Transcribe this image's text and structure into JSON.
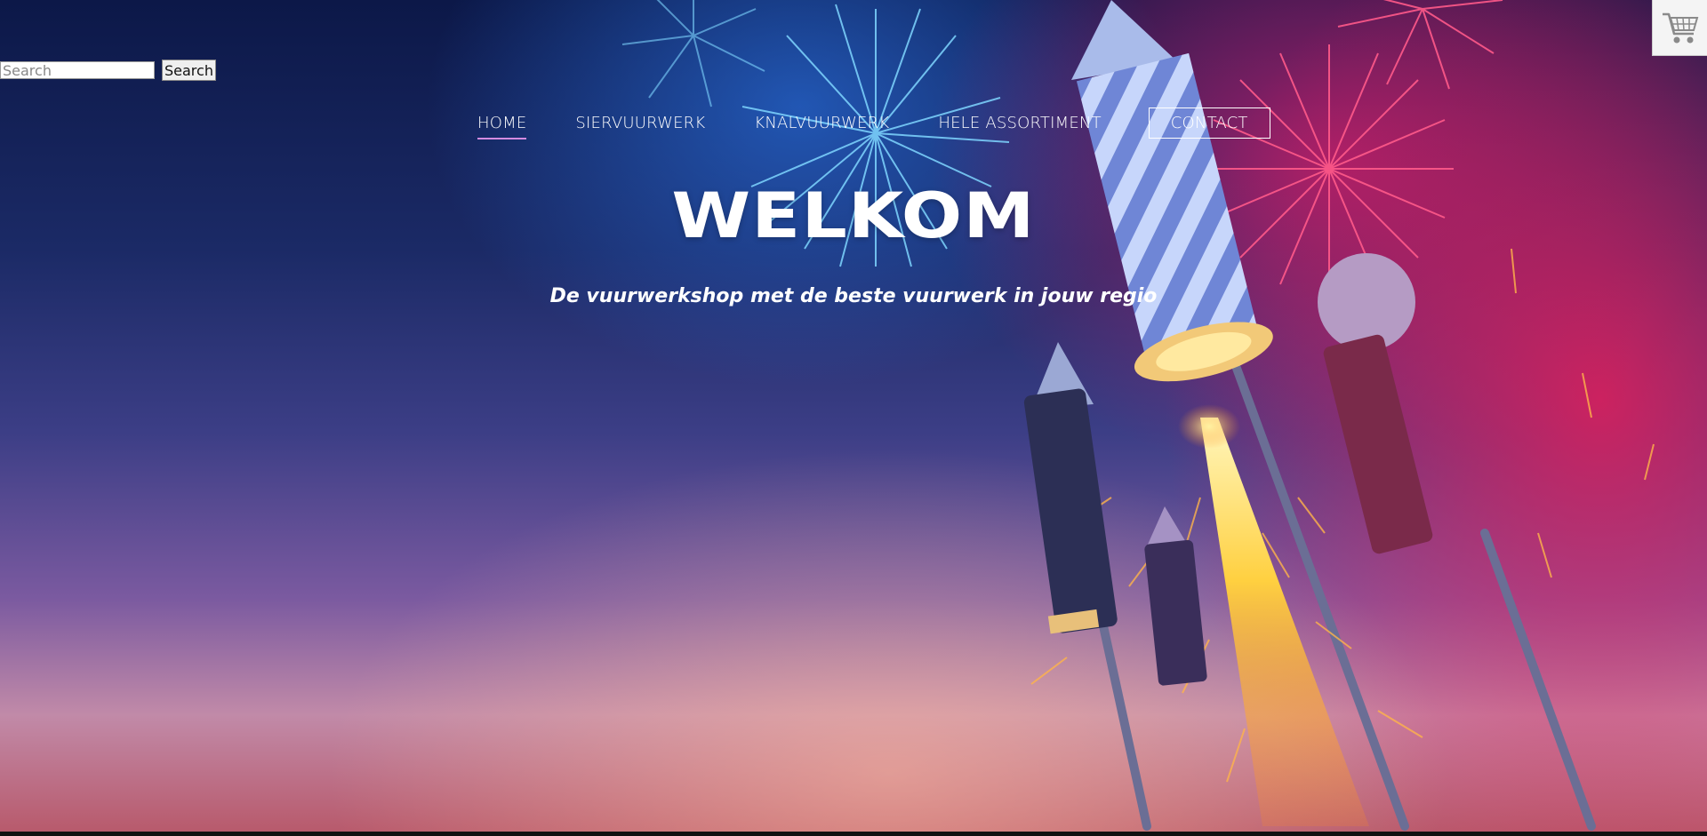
{
  "search": {
    "placeholder": "Search",
    "value": "",
    "button_label": "Search"
  },
  "cart": {
    "icon": "shopping-cart-icon"
  },
  "nav": {
    "items": [
      {
        "label": "HOME",
        "active": true
      },
      {
        "label": "SIERVUURWERK",
        "active": false
      },
      {
        "label": "KNALVUURWERK",
        "active": false
      },
      {
        "label": "HELE ASSORTIMENT",
        "active": false
      },
      {
        "label": "CONTACT",
        "active": false
      }
    ]
  },
  "hero": {
    "title": "WELKOM",
    "subtitle": "De vuurwerkshop met de beste vuurwerk in jouw regio"
  },
  "colors": {
    "active_underline": "#d48be0",
    "text": "#ffffff",
    "sky_top": "#0c1848",
    "sky_pink": "#e61e5a"
  }
}
